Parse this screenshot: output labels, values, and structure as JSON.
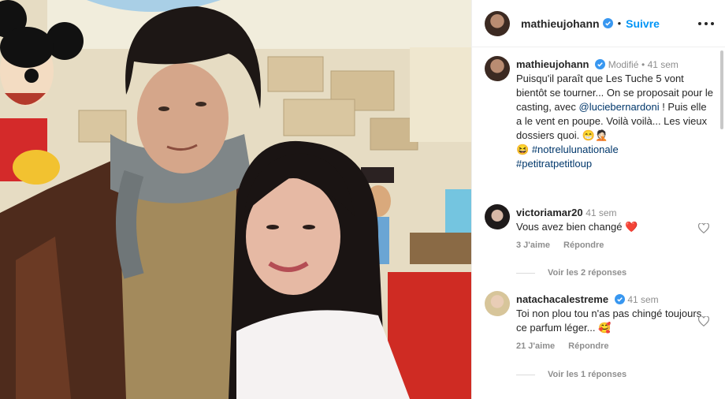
{
  "post": {
    "author": "mathieujohann",
    "follow_label": "Suivre",
    "caption_edited": "Modifié",
    "caption_time": "41 sem",
    "caption_text_1": "Puisqu'il paraît que Les Tuche 5 vont bientôt se tourner... On se proposait pour le casting, avec ",
    "caption_mention": "@luciebernardoni",
    "caption_text_2": " ! Puis elle a le vent en poupe. Voilà voilà... Les vieux dossiers quoi. 😁🤦🏻",
    "caption_text_3": "😆 ",
    "hashtag_1": "#notrelulunationale",
    "hashtag_2": "#petitratpetitloup"
  },
  "comments": [
    {
      "username": "victoriamar20",
      "time": "41 sem",
      "text": "Vous avez bien changé ",
      "emoji": "❤️",
      "likes": "3 J'aime",
      "reply": "Répondre",
      "view_replies": "Voir les 2 réponses"
    },
    {
      "username": "natachacalestreme",
      "time": "41 sem",
      "text": "Toi non plou tou n'as pas chingé toujours ce parfum léger... ",
      "emoji": "🥰",
      "likes": "21 J'aime",
      "reply": "Répondre",
      "view_replies": "Voir les 1 réponses"
    }
  ],
  "colors": {
    "accent": "#0095f6",
    "verified": "#3897f0",
    "heart": "#ed4956",
    "muted": "#8e8e8e"
  },
  "icons": [
    "verified-badge-icon",
    "more-options-icon",
    "heart-icon"
  ]
}
